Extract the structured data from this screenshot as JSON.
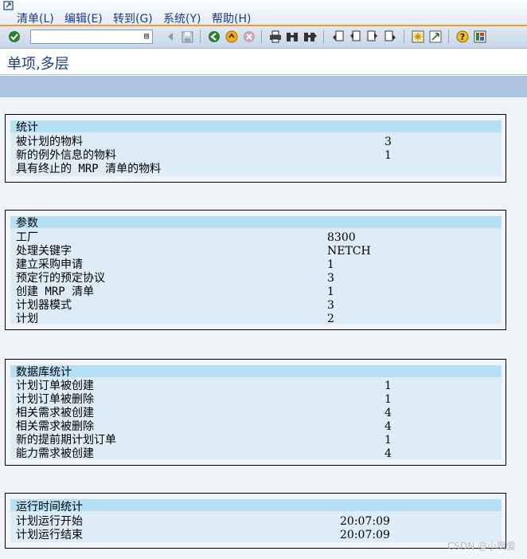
{
  "menu": [
    {
      "label": "清单(L)",
      "name": "menu-list"
    },
    {
      "label": "编辑(E)",
      "name": "menu-edit"
    },
    {
      "label": "转到(G)",
      "name": "menu-goto"
    },
    {
      "label": "系统(Y)",
      "name": "menu-system"
    },
    {
      "label": "帮助(H)",
      "name": "menu-help"
    }
  ],
  "toolbar": {
    "command_value": "",
    "icons": [
      "enter-check-icon",
      "command-dropdown-icon",
      "back-arrow-icon",
      "save-icon",
      "back-icon",
      "exit-icon",
      "cancel-icon",
      "print-icon",
      "find-icon",
      "find-next-icon",
      "first-page-icon",
      "previous-page-icon",
      "next-page-icon",
      "last-page-icon",
      "create-session-icon",
      "shortcut-icon",
      "help-icon",
      "layout-menu-icon"
    ]
  },
  "page_title": "单项,多层",
  "sections": {
    "statistics": {
      "title": "统计",
      "rows": [
        {
          "label": "被计划的物料",
          "value": "3"
        },
        {
          "label": "新的例外信息的物料",
          "value": "1"
        },
        {
          "label": "具有终止的 MRP 清单的物料",
          "value": ""
        }
      ]
    },
    "parameters": {
      "title": "参数",
      "rows": [
        {
          "label": "工厂",
          "value": "8300"
        },
        {
          "label": "处理关键字",
          "value": "NETCH"
        },
        {
          "label": "建立采购申请",
          "value": "1"
        },
        {
          "label": "预定行的预定协议",
          "value": "3"
        },
        {
          "label": "创建 MRP 清单",
          "value": "1"
        },
        {
          "label": "计划器模式",
          "value": "3"
        },
        {
          "label": "计划",
          "value": "2"
        }
      ]
    },
    "database": {
      "title": "数据库统计",
      "rows": [
        {
          "label": "计划订单被创建",
          "value": "1"
        },
        {
          "label": "计划订单被删除",
          "value": "1"
        },
        {
          "label": "相关需求被创建",
          "value": "4"
        },
        {
          "label": "相关需求被删除",
          "value": "4"
        },
        {
          "label": "新的提前期计划订单",
          "value": "1"
        },
        {
          "label": "能力需求被创建",
          "value": "4"
        }
      ]
    },
    "runtime": {
      "title": "运行时间统计",
      "rows": [
        {
          "label": "计划运行开始",
          "value": "20:07:09"
        },
        {
          "label": "计划运行结束",
          "value": "20:07:09"
        }
      ]
    }
  },
  "watermark": "CSDN @小啊爱"
}
